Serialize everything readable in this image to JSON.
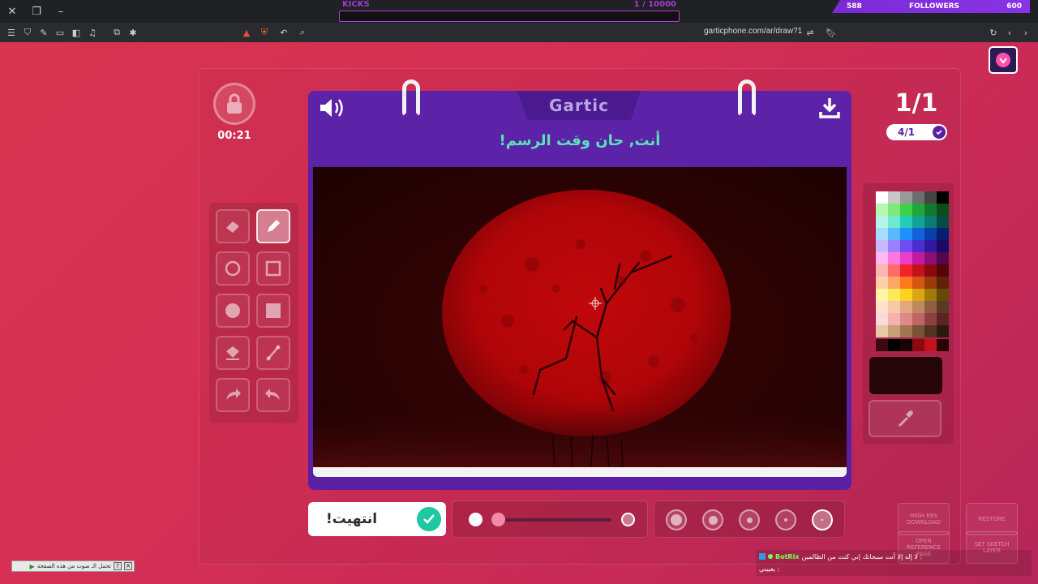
{
  "overlay": {
    "kicks_label": "KICKS",
    "kicks_count": "1  / 10000",
    "followers_left": "588",
    "followers_label": "FOLLOWERS",
    "followers_right": "600"
  },
  "browser": {
    "url": "garticphone.com/ar/draw?1"
  },
  "game": {
    "timer": "00:21",
    "brand": "Gartic",
    "prompt": "أنت, حان وقت الرسم!",
    "round": "1/1",
    "step": "4/1",
    "done_label": "انتهيت!"
  },
  "palette": {
    "rows": [
      [
        "#ffffff",
        "#c8c8c8",
        "#9a9a9a",
        "#6e6e6e",
        "#444444",
        "#000000"
      ],
      [
        "#b8f7b0",
        "#7ee87a",
        "#3fd04a",
        "#1fa83a",
        "#127a2a",
        "#0a4e1c"
      ],
      [
        "#b5f5e8",
        "#6ee8d3",
        "#22cdb4",
        "#10a494",
        "#0b7a70",
        "#064c46"
      ],
      [
        "#a8dcff",
        "#5ab8ff",
        "#1e90ff",
        "#0f62d8",
        "#0a3ea8",
        "#061f6e"
      ],
      [
        "#c7b8ff",
        "#9a80ff",
        "#6e4cf0",
        "#4b2ed0",
        "#3219a0",
        "#1a0a66"
      ],
      [
        "#ffb8f0",
        "#ff78e0",
        "#ee3ec8",
        "#c21aa2",
        "#8c0e78",
        "#56064a"
      ],
      [
        "#ffb3b3",
        "#ff6b6b",
        "#f2242b",
        "#c4111a",
        "#8a0a10",
        "#55050a"
      ],
      [
        "#ffd0a8",
        "#ffa866",
        "#ff7a1e",
        "#d45610",
        "#9c3a08",
        "#602204"
      ],
      [
        "#fff4a8",
        "#ffe85a",
        "#ffd21e",
        "#d8a810",
        "#a07a08",
        "#644a04"
      ],
      [
        "#ffe2cc",
        "#f5c8a6",
        "#e0a880",
        "#c0885e",
        "#8e6040",
        "#5a3a24"
      ],
      [
        "#ffd8d8",
        "#f5b0b0",
        "#e08888",
        "#c06464",
        "#8e4040",
        "#5a2424"
      ],
      [
        "#e8c8a8",
        "#c8a078",
        "#a07850",
        "#785434",
        "#503420",
        "#2c1a0e"
      ]
    ],
    "recent": [
      "#3a0a10",
      "#000000",
      "#1a0206",
      "#8a0a12",
      "#c4111a",
      "#2a0206"
    ]
  },
  "buttons": {
    "high_res": "HIGH RES DOWNLOAD",
    "open_reference": "OPEN REFERENCE PAGE",
    "restore": "RESTORE",
    "set_sketch": "SET SKETCH LAYER"
  },
  "chat": {
    "line1_name": "BotRix",
    "line1_text": "لا إله إلا أنت سبحانك إني كنت من الظالمين :",
    "line2_text": "يعييني :"
  },
  "sound_banner": {
    "text": "تحمل الـ صوت من هذه الصفحة"
  },
  "colors": {
    "card": "#5a1fa3",
    "prompt": "#59e3b6",
    "done_check": "#1ec8a2"
  }
}
